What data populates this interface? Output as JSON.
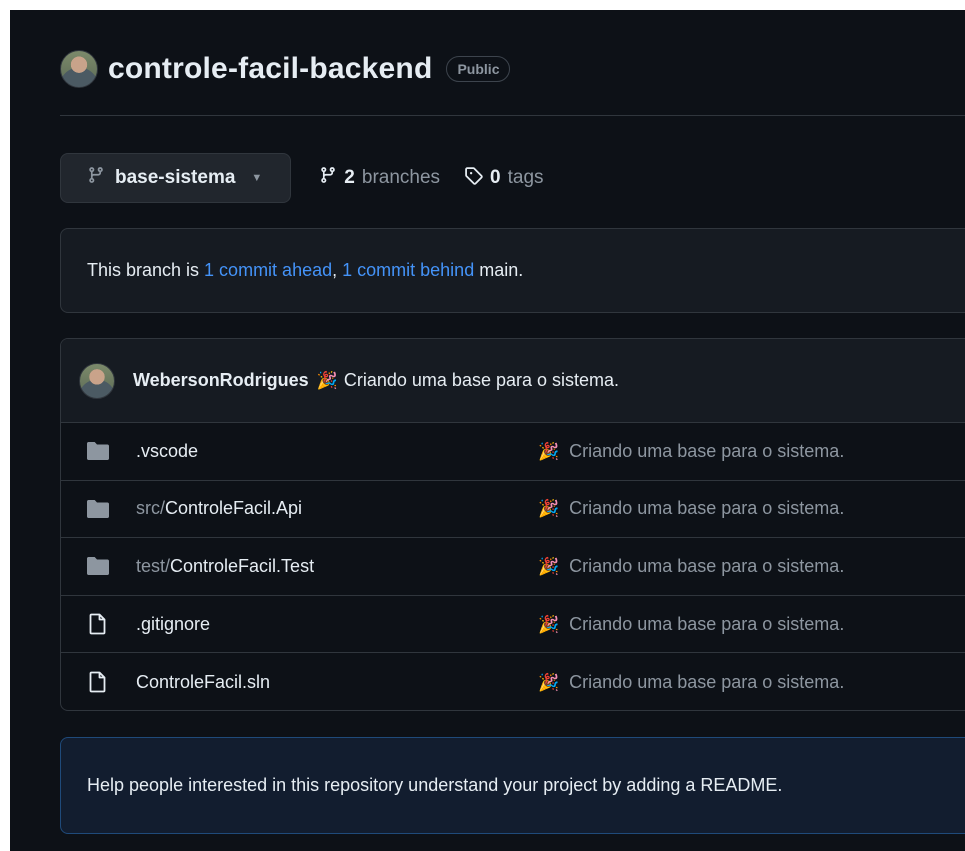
{
  "repo": {
    "name": "controle-facil-backend",
    "visibility": "Public"
  },
  "branch_bar": {
    "current_branch": "base-sistema",
    "branches_count": "2",
    "branches_label": "branches",
    "tags_count": "0",
    "tags_label": "tags"
  },
  "compare": {
    "prefix": "This branch is ",
    "ahead": "1 commit ahead",
    "sep": ", ",
    "behind": "1 commit behind",
    "suffix": " main."
  },
  "latest_commit": {
    "author": "WebersonRodrigues",
    "emoji": "🎉",
    "message": "Criando uma base para o sistema."
  },
  "files": [
    {
      "type": "folder",
      "prefix": "",
      "name": ".vscode",
      "commit": "Criando uma base para o sistema."
    },
    {
      "type": "folder",
      "prefix": "src/",
      "name": "ControleFacil.Api",
      "commit": "Criando uma base para o sistema."
    },
    {
      "type": "folder",
      "prefix": "test/",
      "name": "ControleFacil.Test",
      "commit": "Criando uma base para o sistema."
    },
    {
      "type": "file",
      "prefix": "",
      "name": ".gitignore",
      "commit": "Criando uma base para o sistema."
    },
    {
      "type": "file",
      "prefix": "",
      "name": "ControleFacil.sln",
      "commit": "Criando uma base para o sistema."
    }
  ],
  "readme_prompt": "Help people interested in this repository understand your project by adding a README.",
  "colors": {
    "background": "#0d1117",
    "link": "#4493f8",
    "muted": "#8d96a0",
    "border": "#30363d"
  }
}
